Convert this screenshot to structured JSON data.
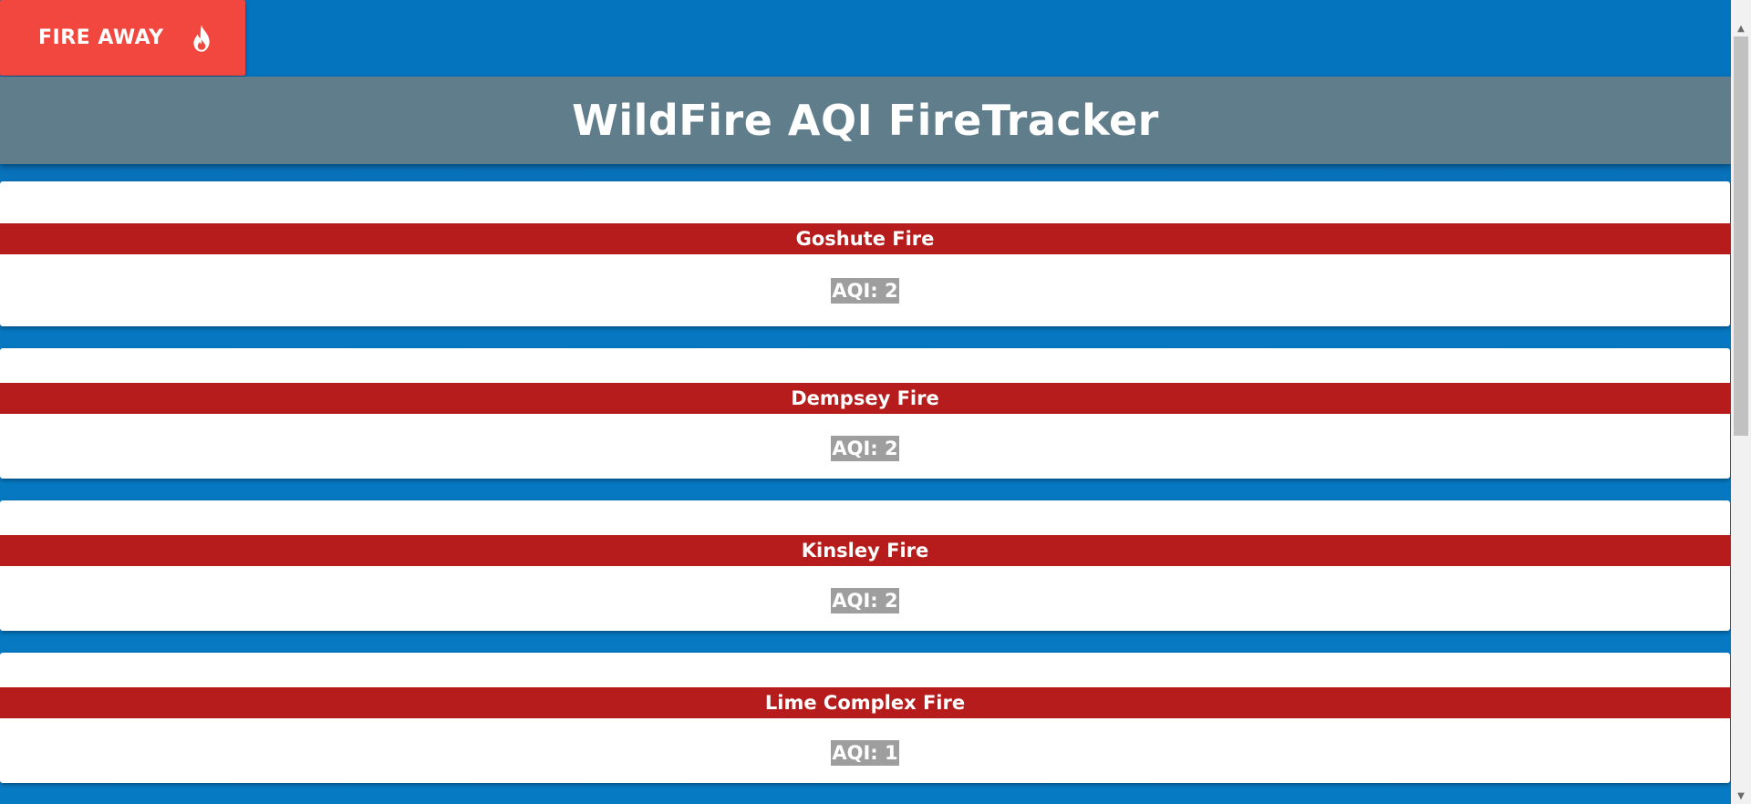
{
  "header": {
    "button_label": "FIRE AWAY",
    "button_icon": "flame-icon",
    "title": "WildFire AQI FireTracker"
  },
  "colors": {
    "background": "#0677c0",
    "button": "#f2473e",
    "title_bar": "#607d8b",
    "fire_name_bar": "#b71c1c",
    "aqi_badge": "#9e9e9e"
  },
  "fires": [
    {
      "name": "Goshute Fire",
      "aqi": "AQI: 2"
    },
    {
      "name": "Dempsey Fire",
      "aqi": "AQI: 2"
    },
    {
      "name": "Kinsley Fire",
      "aqi": "AQI: 2"
    },
    {
      "name": "Lime Complex Fire",
      "aqi": "AQI: 1"
    }
  ]
}
